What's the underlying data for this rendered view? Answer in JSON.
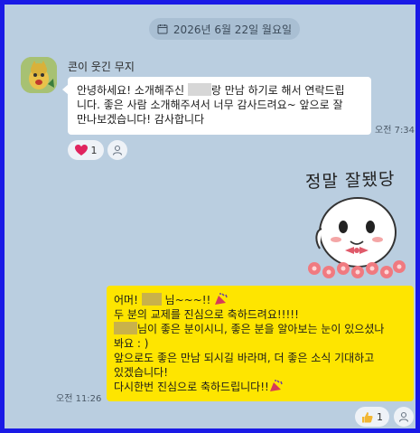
{
  "date_header": {
    "text": "2026년 6월 22일 월요일",
    "icon": "calendar-icon"
  },
  "incoming": {
    "sender": "콘이 웃긴 무지",
    "lines": [
      {
        "pre": "안녕하세요! 소개해주신 ",
        "post": "랑 만남 하기로 해서 연락드립"
      },
      {
        "text": "니다. 좋은 사람 소개해주셔서 너무 감사드려요~ 앞으로 잘"
      },
      {
        "text": "만나보겠습니다! 감사합니다"
      }
    ],
    "time": "오전 7:34",
    "reaction": {
      "icon": "heart-icon",
      "count": "1"
    }
  },
  "sticker": {
    "text": "정말 잘됐당"
  },
  "outgoing": {
    "lines": [
      {
        "pre": "어머! ",
        "post": " 님~~~!!"
      },
      {
        "text": "두 분의 교제를 진심으로 축하드려요!!!!!"
      },
      {
        "post": "님이 좋은 분이시니, 좋은 분을 알아보는 눈이 있으셨나"
      },
      {
        "text": "봐요 : )"
      },
      {
        "text": "앞으로도 좋은 만남 되시길 바라며, 더 좋은 소식 기대하고"
      },
      {
        "text": "있겠습니다!"
      },
      {
        "text": "다시한번 진심으로 축하드립니다!!"
      }
    ],
    "time": "오전 11:26",
    "reaction": {
      "icon": "thumbs-up-icon",
      "count": "1"
    }
  },
  "colors": {
    "chat_background": "#bacee0",
    "frame_border": "#1a1ae6",
    "outgoing_bubble": "#fee500",
    "incoming_bubble": "#ffffff"
  }
}
